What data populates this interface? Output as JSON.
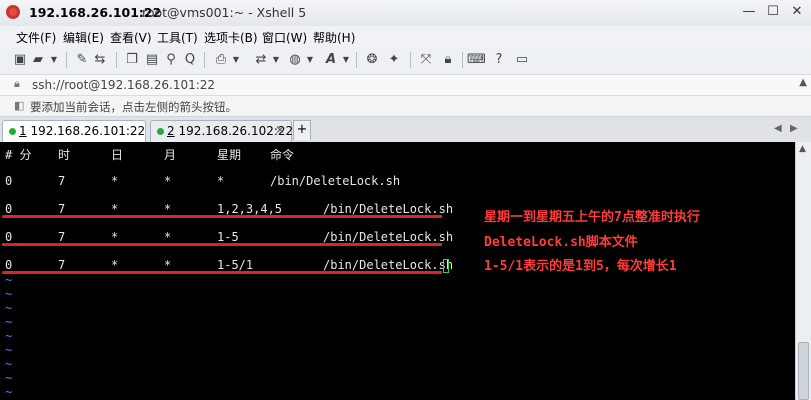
{
  "window": {
    "title_main": "192.168.26.101:22",
    "title_sub": "root@vms001:~ - Xshell 5",
    "minimize": "—",
    "maximize": "☐",
    "close": "✕"
  },
  "menu": [
    "文件(F)",
    "编辑(E)",
    "查看(V)",
    "工具(T)",
    "选项卡(B)",
    "窗口(W)",
    "帮助(H)"
  ],
  "toolbar_icons": [
    "new-session-icon",
    "open-folder-icon",
    "dropdown-icon",
    "properties-icon",
    "reconnect-icon",
    "disconnect-icon",
    "copy-icon",
    "paste-icon",
    "find-icon",
    "print-icon",
    "transfer-icon",
    "globe-icon",
    "font-icon",
    "script-icon",
    "record-icon",
    "fullscreen-icon",
    "lock-icon",
    "keyboard-icon",
    "help-icon"
  ],
  "address": {
    "value": "ssh://root@192.168.26.101:22"
  },
  "hint": {
    "text": "要添加当前会话，点击左侧的箭头按钮。"
  },
  "tabs": [
    {
      "number": "1",
      "label": " 192.168.26.101:22",
      "active": true
    },
    {
      "number": "2",
      "label": " 192.168.26.102:22",
      "active": false
    }
  ],
  "tab_add": "+",
  "terminal": {
    "header": [
      "# 分",
      "时",
      "日",
      "月",
      "星期",
      "命令"
    ],
    "rows": [
      [
        "0",
        "7",
        "*",
        "*",
        "*",
        "/bin/DeleteLock.sh"
      ],
      [
        "0",
        "7",
        "*",
        "*",
        "1,2,3,4,5",
        "/bin/DeleteLock.sh"
      ],
      [
        "0",
        "7",
        "*",
        "*",
        "1-5",
        "/bin/DeleteLock.sh"
      ],
      [
        "0",
        "7",
        "*",
        "*",
        "1-5/1",
        "/bin/DeleteLock.sh"
      ]
    ],
    "tilde": "~",
    "tilde_count": 9
  },
  "annotations": [
    "星期一到星期五上午的7点整准时执行",
    "DeleteLock.sh脚本文件",
    "1-5/1表示的是1到5，每次增长1"
  ],
  "colors": {
    "terminal_bg": "#000000",
    "terminal_fg": "#e6e6e6",
    "annotation": "#ff3b3b",
    "underline": "#d8242b",
    "tilde": "#5a7cff",
    "cursor": "#3bd23b"
  }
}
